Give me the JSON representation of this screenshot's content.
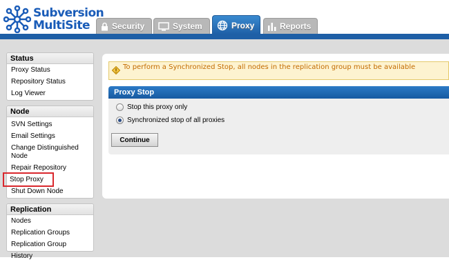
{
  "app": {
    "logo_line1": "Subversion",
    "logo_line2": "MultiSite",
    "brand_color": "#1a5cb8"
  },
  "tabs": [
    {
      "label": "Security",
      "icon": "lock-icon",
      "active": false
    },
    {
      "label": "System",
      "icon": "monitor-icon",
      "active": false
    },
    {
      "label": "Proxy",
      "icon": "globe-icon",
      "active": true
    },
    {
      "label": "Reports",
      "icon": "bar-chart-icon",
      "active": false
    }
  ],
  "sidebar": {
    "status": {
      "title": "Status",
      "items": [
        "Proxy Status",
        "Repository Status",
        "Log Viewer"
      ]
    },
    "node": {
      "title": "Node",
      "items": [
        "SVN Settings",
        "Email Settings",
        "Change Distinguished Node",
        "Repair Repository",
        "Stop Proxy",
        "Shut Down Node"
      ],
      "highlighted": "Stop Proxy"
    },
    "replication": {
      "title": "Replication",
      "items": [
        "Nodes",
        "Replication Groups",
        "Replication Group History"
      ]
    }
  },
  "main": {
    "warning": "To perform a Synchronized Stop, all nodes in the replication group must be available",
    "stop": {
      "title": "Proxy Stop",
      "options": [
        {
          "label": "Stop this proxy only",
          "checked": false
        },
        {
          "label": "Synchronized stop of all proxies",
          "checked": true
        }
      ],
      "continue_label": "Continue"
    }
  },
  "colors": {
    "accent": "#1e5fa6",
    "warning_bg": "#fdf3d0",
    "warning_text": "#c36b00",
    "highlight": "#d9262c"
  }
}
